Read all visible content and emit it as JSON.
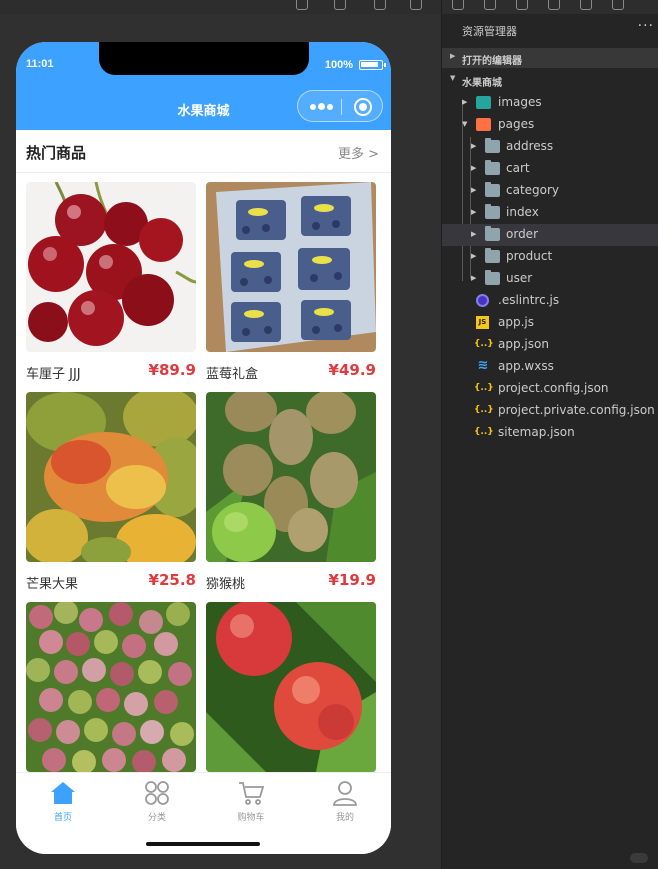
{
  "phone": {
    "status_time": "11:01",
    "battery_text": "100%",
    "nav_title": "水果商城",
    "section_title": "热门商品",
    "section_more": "更多 >"
  },
  "products": [
    {
      "name": "车厘子 JJJ",
      "price": "¥89.9"
    },
    {
      "name": "蓝莓礼盒",
      "price": "¥49.9"
    },
    {
      "name": "芒果大果",
      "price": "¥25.8"
    },
    {
      "name": "猕猴桃",
      "price": "¥19.9"
    },
    {
      "name": "",
      "price": ""
    },
    {
      "name": "",
      "price": ""
    }
  ],
  "tabbar": {
    "items": [
      {
        "label": "首页",
        "icon": "home-icon",
        "active": true
      },
      {
        "label": "分类",
        "icon": "category-icon",
        "active": false
      },
      {
        "label": "购物车",
        "icon": "cart-icon",
        "active": false
      },
      {
        "label": "我的",
        "icon": "user-icon",
        "active": false
      }
    ],
    "active_color": "#3da2ff",
    "inactive_color": "#999999"
  },
  "explorer": {
    "title": "资源管理器",
    "more": "···",
    "open_editors": "打开的编辑器",
    "project": "水果商城",
    "tree": {
      "images": "images",
      "pages": "pages",
      "address": "address",
      "cart": "cart",
      "category": "category",
      "index": "index",
      "order": "order",
      "product": "product",
      "user": "user",
      "eslintrc": ".eslintrc.js",
      "app_js": "app.js",
      "app_json": "app.json",
      "app_wxss": "app.wxss",
      "project_config": "project.config.json",
      "project_private": "project.private.config.json",
      "sitemap": "sitemap.json"
    }
  },
  "colors": {
    "brand": "#3da2ff",
    "price": "#e0393e",
    "editor_bg": "#252526"
  }
}
